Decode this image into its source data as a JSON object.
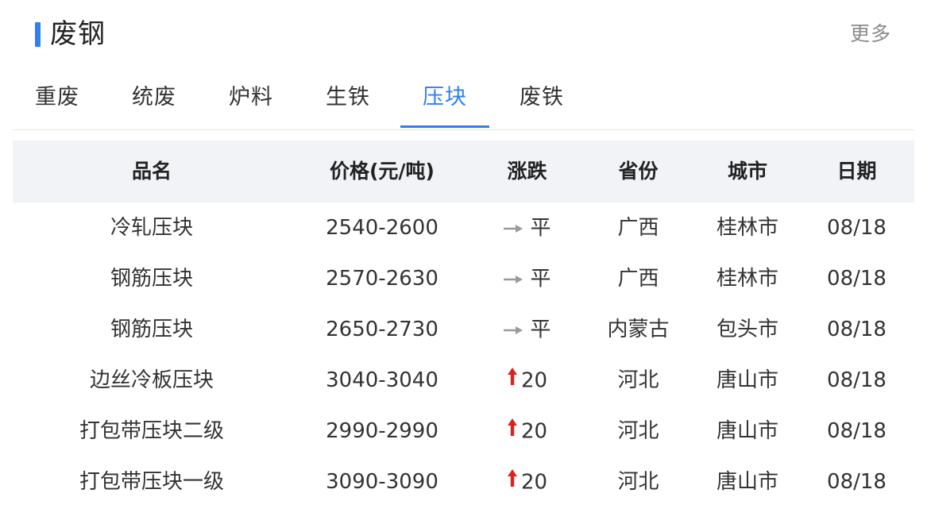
{
  "header": {
    "title": "废钢",
    "more_label": "更多",
    "accent_color": "#2f7ff0"
  },
  "tabs": [
    {
      "label": "重废",
      "active": false
    },
    {
      "label": "统废",
      "active": false
    },
    {
      "label": "炉料",
      "active": false
    },
    {
      "label": "生铁",
      "active": false
    },
    {
      "label": "压块",
      "active": true
    },
    {
      "label": "废铁",
      "active": false
    }
  ],
  "table": {
    "columns": [
      "品名",
      "价格(元/吨)",
      "涨跌",
      "省份",
      "城市",
      "日期"
    ],
    "rows": [
      {
        "name": "冷轧压块",
        "price": "2540-2600",
        "change": "平",
        "change_dir": "flat",
        "province": "广西",
        "city": "桂林市",
        "date": "08/18"
      },
      {
        "name": "钢筋压块",
        "price": "2570-2630",
        "change": "平",
        "change_dir": "flat",
        "province": "广西",
        "city": "桂林市",
        "date": "08/18"
      },
      {
        "name": "钢筋压块",
        "price": "2650-2730",
        "change": "平",
        "change_dir": "flat",
        "province": "内蒙古",
        "city": "包头市",
        "date": "08/18"
      },
      {
        "name": "边丝冷板压块",
        "price": "3040-3040",
        "change": "20",
        "change_dir": "up",
        "province": "河北",
        "city": "唐山市",
        "date": "08/18"
      },
      {
        "name": "打包带压块二级",
        "price": "2990-2990",
        "change": "20",
        "change_dir": "up",
        "province": "河北",
        "city": "唐山市",
        "date": "08/18"
      },
      {
        "name": "打包带压块一级",
        "price": "3090-3090",
        "change": "20",
        "change_dir": "up",
        "province": "河北",
        "city": "唐山市",
        "date": "08/18"
      }
    ]
  },
  "icons": {
    "flat": "arrow-right-icon",
    "up": "arrow-up-icon",
    "up_color": "#e0201b",
    "flat_color": "#9a9a9a"
  }
}
